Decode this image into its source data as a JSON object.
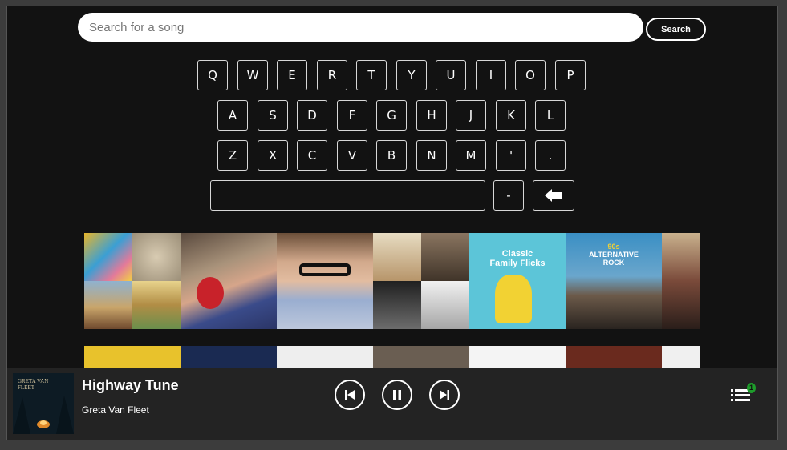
{
  "search": {
    "placeholder": "Search for a song",
    "button_label": "Search"
  },
  "keyboard": {
    "row1": [
      "Q",
      "W",
      "E",
      "R",
      "T",
      "Y",
      "U",
      "I",
      "O",
      "P"
    ],
    "row2": [
      "A",
      "S",
      "D",
      "F",
      "G",
      "H",
      "J",
      "K",
      "L"
    ],
    "row3": [
      "Z",
      "X",
      "C",
      "V",
      "B",
      "N",
      "M",
      "'",
      "."
    ],
    "row4": {
      "space": "",
      "dash": "-",
      "backspace_icon": "backspace-arrow-icon"
    }
  },
  "albums_row1": [
    {
      "name": "album-collage-1",
      "lines": []
    },
    {
      "name": "album-boy-spiderman",
      "lines": []
    },
    {
      "name": "album-boy-glasses",
      "lines": []
    },
    {
      "name": "album-collage-2",
      "lines": []
    },
    {
      "name": "playlist-classic-family-flicks",
      "lines": [
        "Classic",
        "Family Flicks"
      ]
    },
    {
      "name": "playlist-90s-alternative-rock",
      "lines": [
        "90s",
        "ALTERNATIVE",
        "ROCK"
      ]
    },
    {
      "name": "album-partial",
      "lines": []
    }
  ],
  "now_playing": {
    "title": "Highway Tune",
    "artist": "Greta Van Fleet",
    "queue_count": "1",
    "cover_text": "GRETA VAN FLEET"
  },
  "colors": {
    "background": "#121212",
    "player": "#232323",
    "badge": "#1e9c2b",
    "accent": "#ffffff"
  }
}
